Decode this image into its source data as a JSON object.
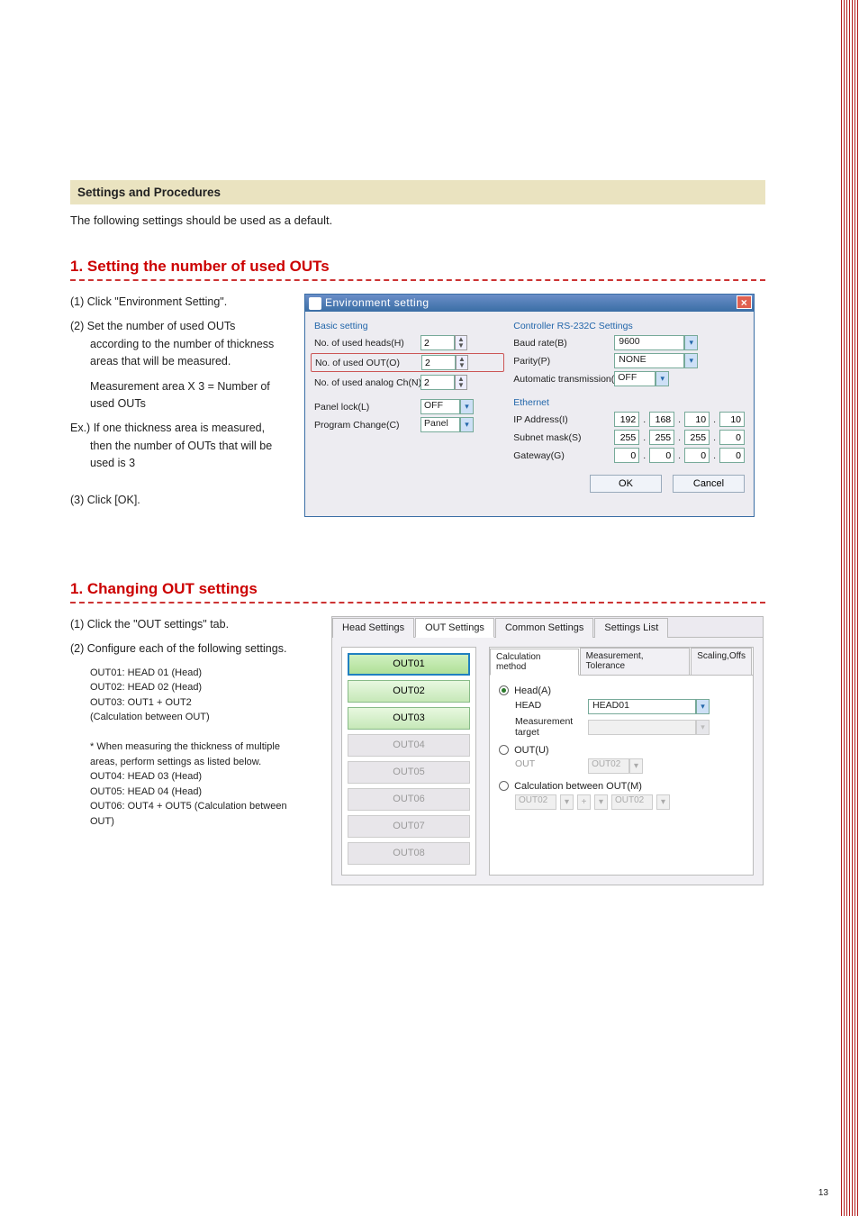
{
  "banner": "Settings and Procedures",
  "intro": "The following settings should be used as a default.",
  "section1": {
    "heading": "1. Setting the number of used OUTs",
    "text": {
      "p1": "(1) Click \"Environment Setting\".",
      "p2": "(2) Set the number of used OUTs according to the number of thickness areas that will be measured.",
      "p2b": "Measurement area X 3 = Number of used OUTs",
      "p2c": "Ex.) If one thickness area is measured, then the number of OUTs that will be used is 3",
      "p3": "(3) Click [OK]."
    },
    "dialog": {
      "title": "Environment setting",
      "left_group": "Basic setting",
      "heads_label": "No. of used heads(H)",
      "heads_value": "2",
      "outs_label": "No. of used OUT(O)",
      "outs_value": "2",
      "analog_label": "No. of used analog Ch(N)",
      "analog_value": "2",
      "panel_lock_label": "Panel lock(L)",
      "panel_lock_value": "OFF",
      "prog_change_label": "Program Change(C)",
      "prog_change_value": "Panel",
      "right_group": "Controller RS-232C Settings",
      "baud_label": "Baud rate(B)",
      "baud_value": "9600",
      "parity_label": "Parity(P)",
      "parity_value": "NONE",
      "auto_label": "Automatic transmission(A)",
      "auto_value": "OFF",
      "eth_group": "Ethernet",
      "ip_label": "IP Address(I)",
      "ip": [
        "192",
        "168",
        "10",
        "10"
      ],
      "subnet_label": "Subnet mask(S)",
      "subnet": [
        "255",
        "255",
        "255",
        "0"
      ],
      "gateway_label": "Gateway(G)",
      "gateway": [
        "0",
        "0",
        "0",
        "0"
      ],
      "ok": "OK",
      "cancel": "Cancel"
    }
  },
  "section2": {
    "heading": "1. Changing OUT settings",
    "text": {
      "p1": "(1) Click the \"OUT settings\" tab.",
      "p2": "(2) Configure each of the following settings.",
      "l1": "OUT01: HEAD 01 (Head)",
      "l2": "OUT02: HEAD 02 (Head)",
      "l3": "OUT03: OUT1 + OUT2",
      "l4": "(Calculation between OUT)",
      "note": "* When measuring the thickness of multiple areas, perform settings as listed below.",
      "l5": "OUT04: HEAD 03 (Head)",
      "l6": "OUT05: HEAD 04 (Head)",
      "l7": "OUT06: OUT4 + OUT5 (Calculation between OUT)"
    },
    "tabs": [
      "Head Settings",
      "OUT Settings",
      "Common Settings",
      "Settings List"
    ],
    "out_list": [
      "OUT01",
      "OUT02",
      "OUT03",
      "OUT04",
      "OUT05",
      "OUT06",
      "OUT07",
      "OUT08"
    ],
    "subtabs": [
      "Calculation method",
      "Measurement, Tolerance",
      "Scaling,Offs"
    ],
    "radios": {
      "head": "Head(A)",
      "head_label": "HEAD",
      "head_value": "HEAD01",
      "target_label": "Measurement target",
      "target_value": "",
      "out": "OUT(U)",
      "out_label": "OUT",
      "out_value": "OUT02",
      "calc": "Calculation between OUT(M)",
      "calc_a": "OUT02",
      "calc_op": "+",
      "calc_b": "OUT02"
    }
  },
  "page_number": "13"
}
